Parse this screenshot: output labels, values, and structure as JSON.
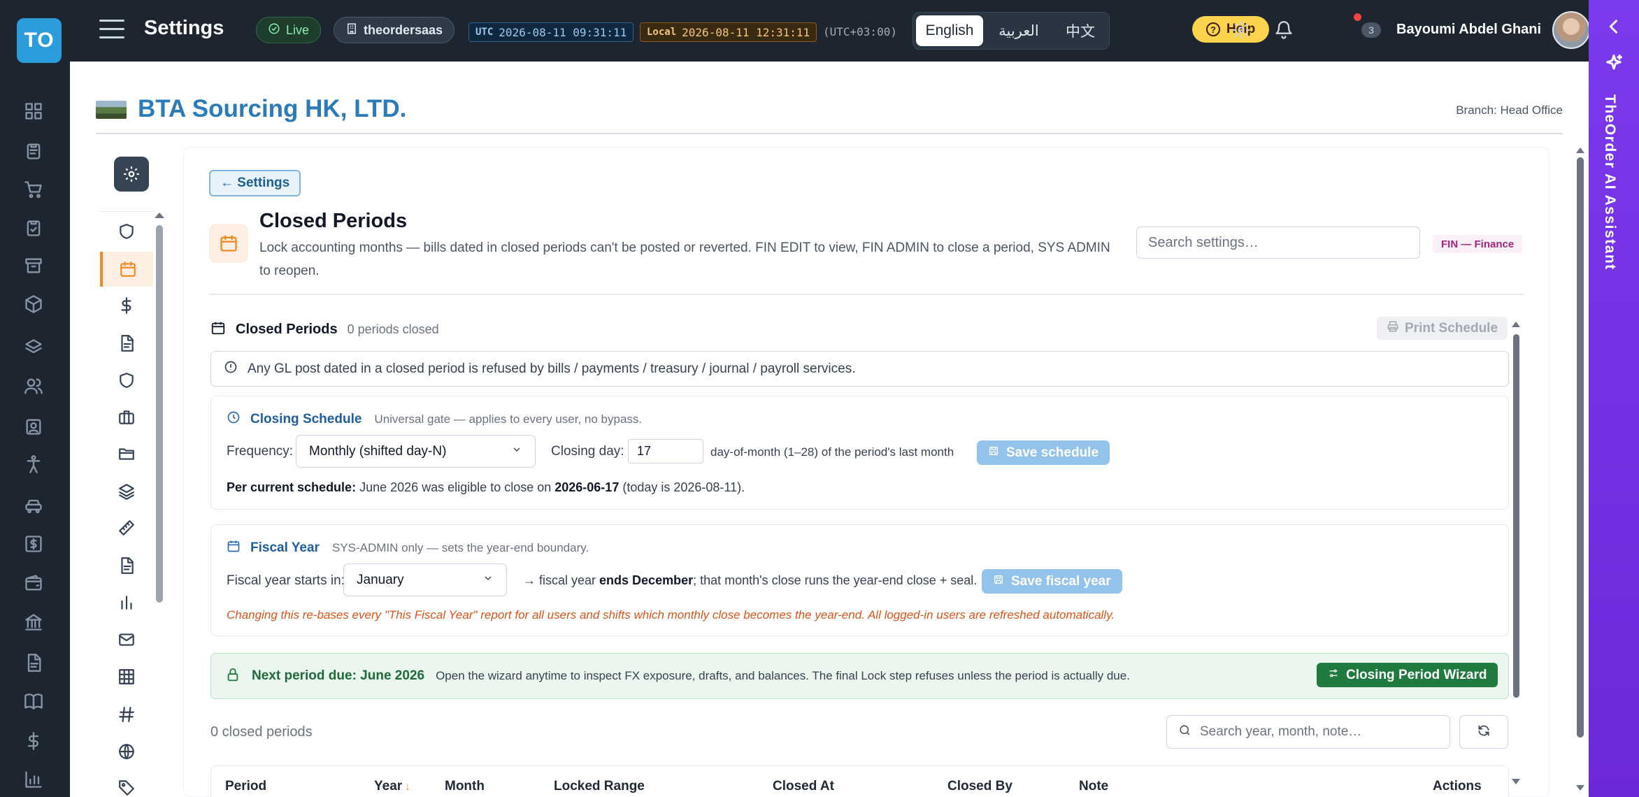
{
  "app": {
    "logo_text": "TO",
    "title": "Settings"
  },
  "topbar": {
    "live_label": "Live",
    "tenant": "theordersaas",
    "utc_tag": "UTC",
    "utc_time": "2026-08-11 09:31:11",
    "local_tag": "Local",
    "local_time": "2026-08-11 12:31:11",
    "tz_offset": "(UTC+03:00)",
    "languages": [
      "English",
      "العربية",
      "中文"
    ],
    "active_language": "English",
    "help_label": "Help",
    "notifications_count": "3",
    "user_name": "Bayoumi Abdel Ghani"
  },
  "ai_assistant": {
    "label": "TheOrder AI Assistant"
  },
  "company": {
    "name": "BTA Sourcing HK, LTD.",
    "branch": "Branch: Head Office"
  },
  "page": {
    "back_label": "← Settings",
    "title": "Closed Periods",
    "description": "Lock accounting months — bills dated in closed periods can't be posted or reverted. FIN EDIT to view, FIN ADMIN to close a period, SYS ADMIN to reopen.",
    "search_placeholder": "Search settings…",
    "badge": "FIN — Finance"
  },
  "closed_periods": {
    "title": "Closed Periods",
    "summary": "0 periods closed",
    "print_label": "Print Schedule",
    "info": "Any GL post dated in a closed period is refused by bills / payments / treasury / journal / payroll services."
  },
  "closing_schedule": {
    "title": "Closing Schedule",
    "subtitle": "Universal gate — applies to every user, no bypass.",
    "frequency_label": "Frequency:",
    "frequency_value": "Monthly (shifted day-N)",
    "closing_day_label": "Closing day:",
    "closing_day_value": "17",
    "closing_day_hint": "day-of-month (1–28) of the period's last month",
    "save_label": "Save schedule",
    "current_prefix": "Per current schedule:",
    "current_mid": " June 2026 was eligible to close on ",
    "current_date": "2026-06-17",
    "current_suffix": " (today is 2026-08-11)."
  },
  "fiscal_year": {
    "title": "Fiscal Year",
    "subtitle": "SYS-ADMIN only — sets the year-end boundary.",
    "start_label": "Fiscal year starts in:",
    "start_value": "January",
    "ends_prefix": "→ fiscal year ",
    "ends_bold": "ends December",
    "ends_suffix": "; that month's close runs the year-end close + seal.",
    "save_label": "Save fiscal year",
    "warning": "Changing this re-bases every \"This Fiscal Year\" report for all users and shifts which monthly close becomes the year-end. All logged-in users are refreshed automatically."
  },
  "next_period": {
    "title": "Next period due: June 2026",
    "text": "Open the wizard anytime to inspect FX exposure, drafts, and balances. The final Lock step refuses unless the period is actually due.",
    "wizard_label": "Closing Period Wizard"
  },
  "table": {
    "count_label": "0 closed periods",
    "search_placeholder": "Search year, month, note…",
    "columns": [
      "Period",
      "Year",
      "Month",
      "Locked Range",
      "Closed At",
      "Closed By",
      "Note",
      "Actions"
    ],
    "sort_indicator": "↓"
  },
  "colors": {
    "rail_bg": "#1c2530",
    "accent_orange": "#f08a24",
    "brand_blue": "#2b7bb9",
    "ai_purple": "#7c3aed",
    "success_green": "#1f7a3f"
  }
}
